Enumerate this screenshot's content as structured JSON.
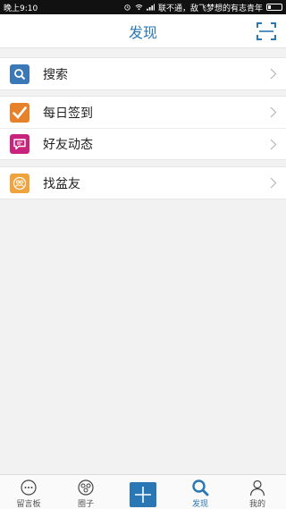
{
  "status_bar": {
    "time": "晚上9:10",
    "carrier": "联不通，敌飞梦想的有志青年"
  },
  "header": {
    "title": "发现"
  },
  "menu": {
    "search": "搜索",
    "checkin": "每日签到",
    "friends_feed": "好友动态",
    "find_friends": "找盆友"
  },
  "tabbar": {
    "tabs": [
      {
        "label": "留言板"
      },
      {
        "label": "圈子"
      },
      {
        "label": ""
      },
      {
        "label": "发现"
      },
      {
        "label": "我的"
      }
    ],
    "active": "发现"
  },
  "colors": {
    "accent": "#2a77b5",
    "search_icon": "#3b78b8",
    "checkin_icon": "#e8822a",
    "friends_icon": "#c9247d",
    "find_icon": "#f0a23c"
  }
}
